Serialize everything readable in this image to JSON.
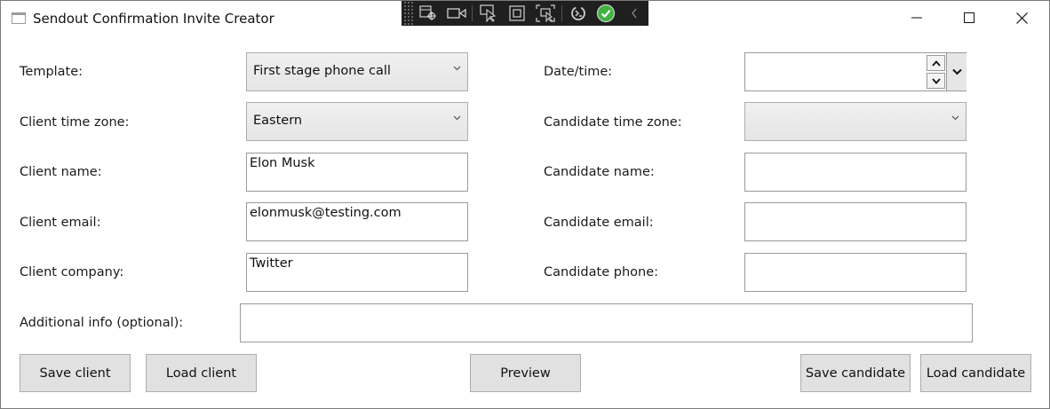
{
  "window": {
    "title": "Sendout Confirmation Invite Creator"
  },
  "dev_toolbar": {
    "tools": [
      "select-element-icon",
      "video-icon",
      "pointer-icon",
      "adorner-icon",
      "layout-icon",
      "hot-reload-icon",
      "check-icon",
      "collapse-icon"
    ]
  },
  "form": {
    "template_label": "Template:",
    "template_value": "First stage phone call",
    "client_tz_label": "Client time zone:",
    "client_tz_value": "Eastern",
    "client_name_label": "Client name:",
    "client_name_value": "Elon Musk",
    "client_email_label": "Client email:",
    "client_email_value": "elonmusk@testing.com",
    "client_company_label": "Client company:",
    "client_company_value": "Twitter",
    "datetime_label": "Date/time:",
    "datetime_value": "",
    "candidate_tz_label": "Candidate time zone:",
    "candidate_tz_value": "",
    "candidate_name_label": "Candidate name:",
    "candidate_name_value": "",
    "candidate_email_label": "Candidate email:",
    "candidate_email_value": "",
    "candidate_phone_label": "Candidate phone:",
    "candidate_phone_value": "",
    "additional_label": "Additional info (optional):",
    "additional_value": ""
  },
  "buttons": {
    "save_client": "Save client",
    "load_client": "Load client",
    "preview": "Preview",
    "save_candidate": "Save candidate",
    "load_candidate": "Load candidate"
  },
  "colors": {
    "check_green": "#3fb23f",
    "devbar_bg": "#1f1f1f",
    "button_bg": "#e1e1e1"
  }
}
